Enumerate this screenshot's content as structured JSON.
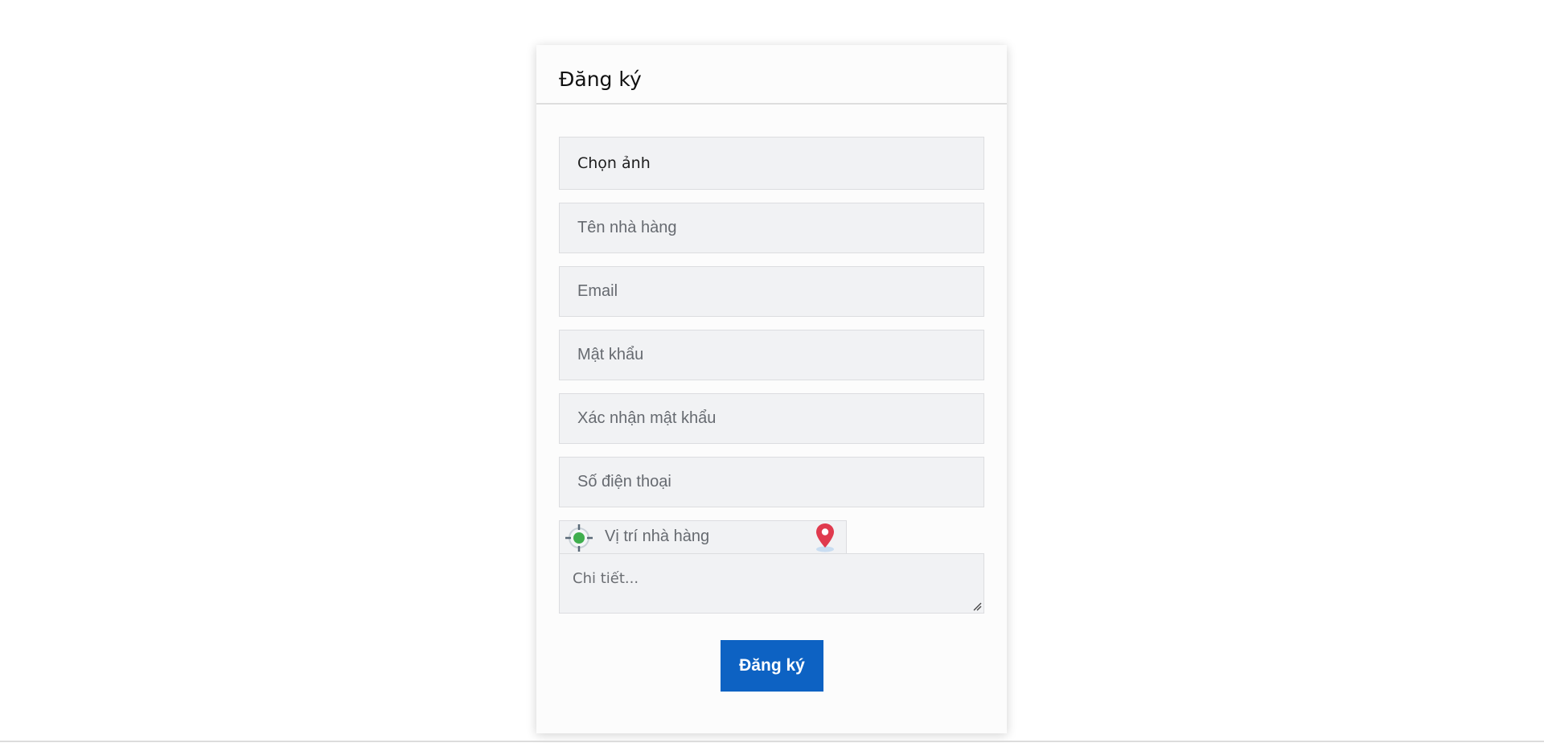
{
  "form": {
    "title": "Đăng ký",
    "file_label": "Chọn ảnh",
    "fields": {
      "restaurant_name": "Tên nhà hàng",
      "email": "Email",
      "password": "Mật khẩu",
      "confirm_password": "Xác nhận mật khẩu",
      "phone": "Số điện thoại"
    },
    "location_placeholder": "Vị trí nhà hàng",
    "details_placeholder": "Chi tiết...",
    "submit_label": "Đăng ký"
  },
  "icons": {
    "locate": "crosshair-target-icon",
    "pin": "map-pin-icon"
  },
  "colors": {
    "submit_bg": "#0d62c3",
    "pin": "#e03a4e",
    "target_dot": "#3fae4e",
    "field_bg": "#f1f2f4"
  }
}
